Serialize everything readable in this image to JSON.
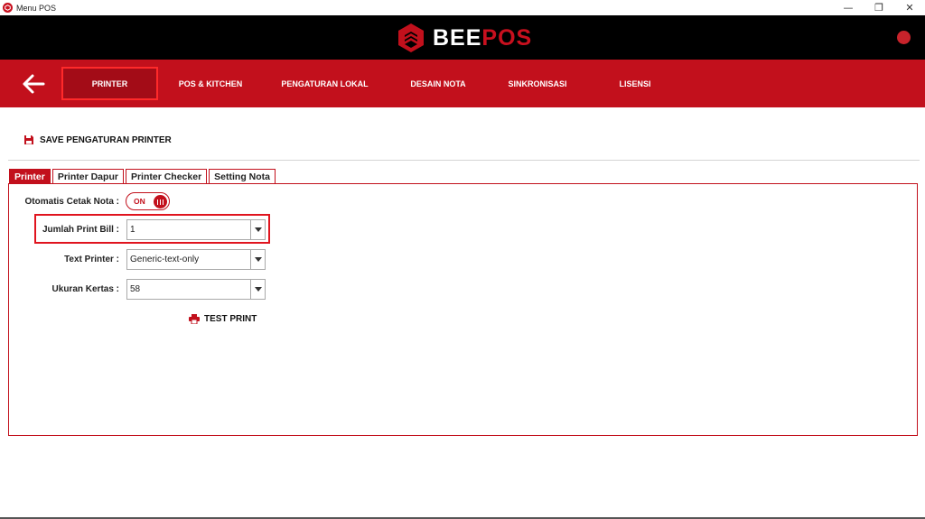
{
  "window": {
    "title": "Menu POS",
    "controls": {
      "minimize": "—",
      "restore": "❐",
      "close": "✕"
    }
  },
  "brand": {
    "part1": "BEE",
    "part2": "POS",
    "accent_color": "#c2101c",
    "status_dot_color": "#c8232b"
  },
  "nav": {
    "back_icon": "arrow-left-icon",
    "items": [
      {
        "label": "PRINTER",
        "active": true
      },
      {
        "label": "POS & KITCHEN",
        "active": false
      },
      {
        "label": "PENGATURAN LOKAL",
        "active": false
      },
      {
        "label": "DESAIN NOTA",
        "active": false
      },
      {
        "label": "SINKRONISASI",
        "active": false
      },
      {
        "label": "LISENSI",
        "active": false
      }
    ]
  },
  "toolbar": {
    "save_label": "SAVE PENGATURAN PRINTER",
    "save_icon": "floppy-disk-icon"
  },
  "tabs": [
    {
      "label": "Printer",
      "active": true
    },
    {
      "label": "Printer Dapur",
      "active": false
    },
    {
      "label": "Printer Checker",
      "active": false
    },
    {
      "label": "Setting Nota",
      "active": false
    }
  ],
  "form": {
    "auto_print": {
      "label": "Otomatis Cetak Nota :",
      "state": "ON"
    },
    "print_bill_count": {
      "label": "Jumlah Print Bill :",
      "value": "1"
    },
    "text_printer": {
      "label": "Text Printer :",
      "value": "Generic-text-only"
    },
    "paper_size": {
      "label": "Ukuran Kertas :",
      "value": "58"
    },
    "test_print": {
      "label": "TEST PRINT",
      "icon": "printer-icon"
    }
  }
}
